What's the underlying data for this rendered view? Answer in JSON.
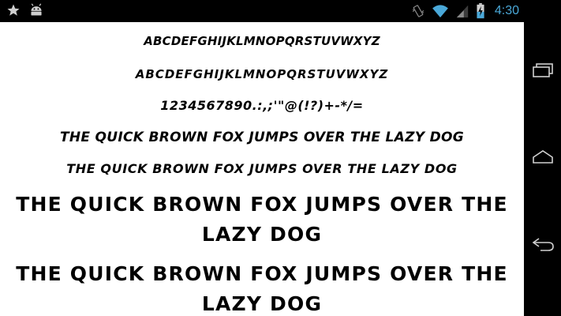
{
  "status_bar": {
    "time": "4:30",
    "icons": [
      "star-icon",
      "android-icon",
      "vibrate-icon",
      "wifi-icon",
      "signal-icon",
      "battery-charging-icon"
    ]
  },
  "preview": {
    "lines": [
      "ABCDEFGHIJKLMNOPQRSTUVWXYZ",
      "ABCDEFGHIJKLMNOPQRSTUVWXYZ",
      "1234567890.:,;'\"@(!?)+-*/=",
      "THE QUICK BROWN FOX JUMPS OVER THE LAZY DOG",
      "THE QUICK BROWN FOX JUMPS OVER THE LAZY DOG",
      "THE QUICK BROWN FOX JUMPS OVER THE LAZY DOG",
      "THE QUICK BROWN FOX JUMPS OVER THE LAZY DOG"
    ]
  },
  "nav_bar": {
    "buttons": [
      "recent-apps-icon",
      "home-icon",
      "back-icon"
    ]
  },
  "colors": {
    "status_accent": "#4aa8d8",
    "background": "#ffffff",
    "bars": "#000000"
  }
}
